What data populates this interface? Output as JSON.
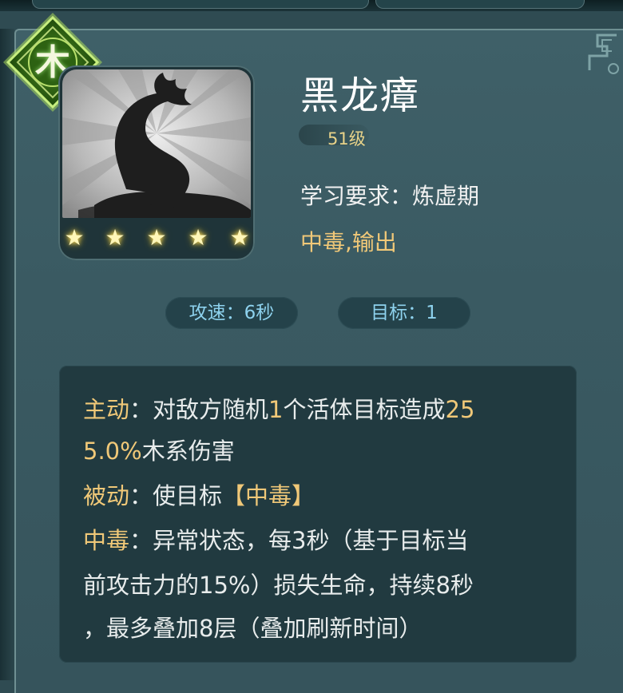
{
  "skill": {
    "element": "木",
    "name": "黑龙瘴",
    "level": "51级",
    "requirement": "学习要求：炼虚期",
    "tags": "中毒,输出",
    "stars": 5
  },
  "stats": {
    "attack_speed": "攻速：6秒",
    "target": "目标：1"
  },
  "description": {
    "active_label": "主动",
    "active_line1_text": "：对敌方随机",
    "active_line1_num": "1",
    "active_line1_text2": "个活体目标造成",
    "active_line1_num2": "25",
    "active_line2_num": "5.0%",
    "active_line2_text": "木系伤害",
    "passive_label": "被动",
    "passive_text": "：使目标",
    "passive_tag": "【中毒】",
    "poison_label": "中毒",
    "poison_line1": "：异常状态，每3秒（基于目标当",
    "poison_line2": "前攻击力的15%）损失生命，持续8秒",
    "poison_line3": "，最多叠加8层（叠加刷新时间）"
  },
  "colors": {
    "accent_gold": "#f0c878",
    "stat_blue": "#8ed2ee",
    "element_green": "#5f9e2a"
  },
  "icons": {
    "element_badge": "wood-element-icon",
    "star": "star-icon"
  }
}
